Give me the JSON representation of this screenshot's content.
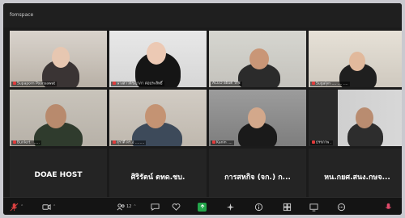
{
  "app": {
    "title": "fomspace"
  },
  "participants": [
    {
      "label": "Supaporn Poonsawat"
    },
    {
      "label": "นางสาวพิชญาภา ต่อประสิทธิ์"
    },
    {
      "label": "ACEO อธิบดี วิรัช"
    },
    {
      "label": "Sugalyn ....  .... ...."
    },
    {
      "label": "Bunlert · ....."
    },
    {
      "label": "สุรวัศิ์ ดร.อ ........"
    },
    {
      "label": "Kanin ...."
    },
    {
      "label": "ธรรภาพ ."
    },
    {
      "label": "DOAE HOST",
      "name": "DOAE HOST"
    },
    {
      "label": "ศิริรัตน์ ตทด.ชบ.",
      "name": "ศิริรัตน์ ตทด.ชบ."
    },
    {
      "label": "การสหกิจ (จก.) กทม.3",
      "name": "การสหกิจ (จก.) ก..."
    },
    {
      "label": "หน.กยศ.สนง.กษจ.",
      "name": "หน.กยศ.สนง.กษจ..."
    }
  ],
  "toolbar": {
    "participants_count": "12"
  },
  "colors": {
    "active_speaker": "#2fcf5f",
    "muted": "#e03b3b",
    "share": "#23a54a"
  }
}
